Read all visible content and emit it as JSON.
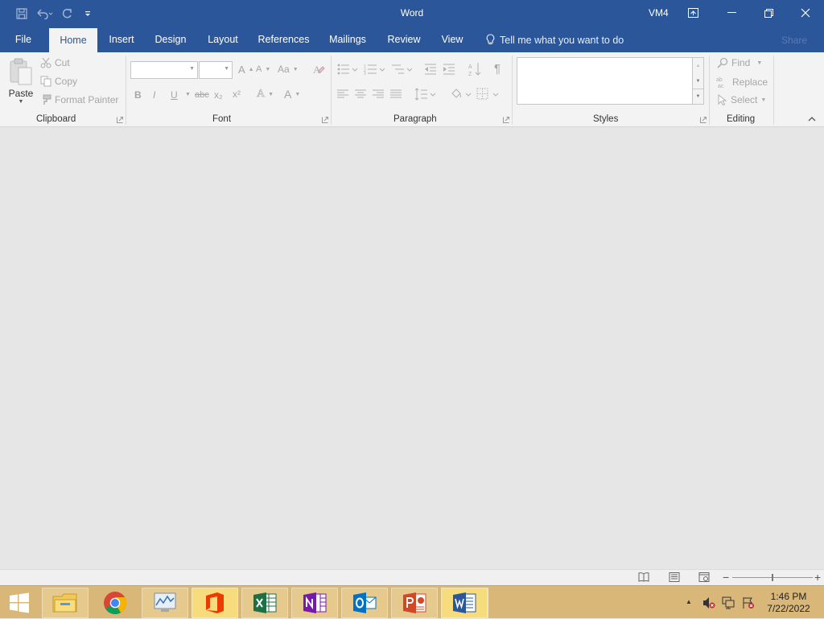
{
  "window": {
    "app_title": "Word",
    "user": "VM4",
    "quick_access": [
      "save-icon",
      "undo-icon",
      "redo-icon",
      "customize-qat-icon"
    ]
  },
  "tabs": [
    {
      "label": "File"
    },
    {
      "label": "Home",
      "active": true
    },
    {
      "label": "Insert"
    },
    {
      "label": "Design"
    },
    {
      "label": "Layout"
    },
    {
      "label": "References"
    },
    {
      "label": "Mailings"
    },
    {
      "label": "Review"
    },
    {
      "label": "View"
    }
  ],
  "tell_me": {
    "placeholder": "Tell me what you want to do"
  },
  "share_label": "Share",
  "ribbon": {
    "clipboard": {
      "group_label": "Clipboard",
      "paste_label": "Paste",
      "cut_label": "Cut",
      "copy_label": "Copy",
      "format_painter_label": "Format Painter"
    },
    "font": {
      "group_label": "Font",
      "font_name": "",
      "font_size": "",
      "bold": "B",
      "italic": "I",
      "underline": "U",
      "strike": "abc",
      "subscript": "x₂",
      "superscript": "x²",
      "grow": "A",
      "shrink": "A",
      "change_case": "Aa",
      "effects": "A",
      "font_color": "A"
    },
    "paragraph": {
      "group_label": "Paragraph",
      "pilcrow": "¶"
    },
    "styles": {
      "group_label": "Styles"
    },
    "editing": {
      "group_label": "Editing",
      "find_label": "Find",
      "replace_label": "Replace",
      "select_label": "Select"
    }
  },
  "taskbar": {
    "apps": [
      {
        "name": "file-explorer-icon"
      },
      {
        "name": "chrome-icon"
      },
      {
        "name": "resource-monitor-icon"
      },
      {
        "name": "office-icon"
      },
      {
        "name": "excel-icon"
      },
      {
        "name": "onenote-icon"
      },
      {
        "name": "outlook-icon"
      },
      {
        "name": "powerpoint-icon"
      },
      {
        "name": "word-icon"
      }
    ],
    "clock": {
      "time": "1:46 PM",
      "date": "7/22/2022"
    }
  },
  "colors": {
    "word_blue": "#2b579a",
    "ribbon_bg": "#f3f3f3",
    "doc_bg": "#e6e6e6",
    "taskbar": "#d8b778"
  }
}
